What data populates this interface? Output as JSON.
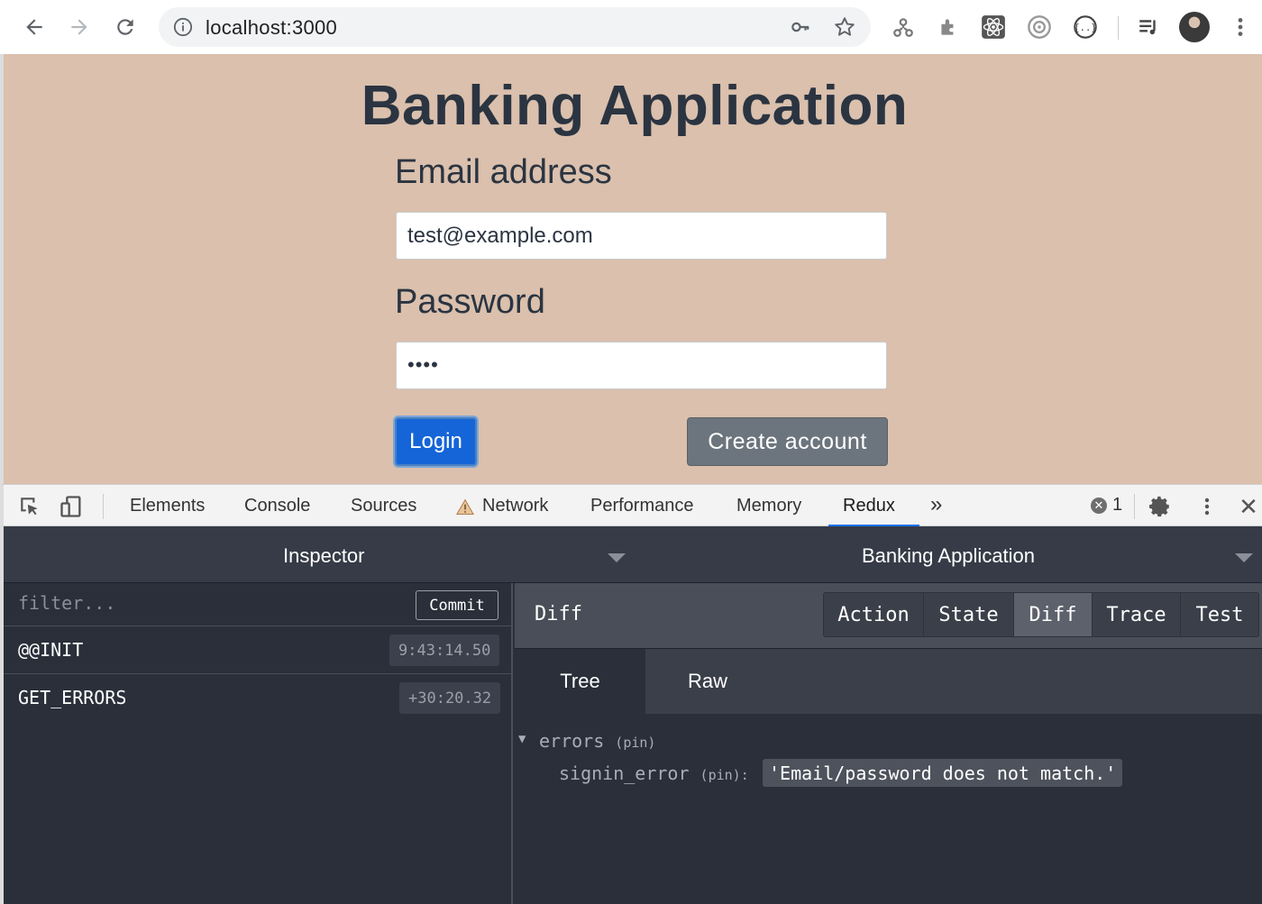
{
  "browser": {
    "url": "localhost:3000"
  },
  "page": {
    "title": "Banking Application",
    "email_label": "Email address",
    "email_value": "test@example.com",
    "password_label": "Password",
    "password_value": "••••",
    "login_label": "Login",
    "create_label": "Create account"
  },
  "devtools": {
    "tabs": [
      "Elements",
      "Console",
      "Sources",
      "Network",
      "Performance",
      "Memory",
      "Redux"
    ],
    "more": "»",
    "active_tab": "Redux",
    "error_count": "1",
    "close": "✕"
  },
  "redux": {
    "monitor": "Inspector",
    "instance": "Banking Application",
    "filter_placeholder": "filter...",
    "commit_label": "Commit",
    "actions": [
      {
        "name": "@@INIT",
        "time": "9:43:14.50"
      },
      {
        "name": "GET_ERRORS",
        "time": "+30:20.32"
      }
    ],
    "current_view": "Diff",
    "view_buttons": [
      "Action",
      "State",
      "Diff",
      "Trace",
      "Test"
    ],
    "subtabs": [
      "Tree",
      "Raw"
    ],
    "tree": {
      "root_key": "errors",
      "pin": "(pin)",
      "child_key": "signin_error",
      "child_pin": "(pin):",
      "child_value": "'Email/password does not match.'"
    }
  },
  "colors": {
    "page_bg": "#dac0ad",
    "login_btn": "#1565d8",
    "create_btn": "#6c757d",
    "redux_bg": "#2a2f3a",
    "devtools_accent": "#1a73e8"
  }
}
